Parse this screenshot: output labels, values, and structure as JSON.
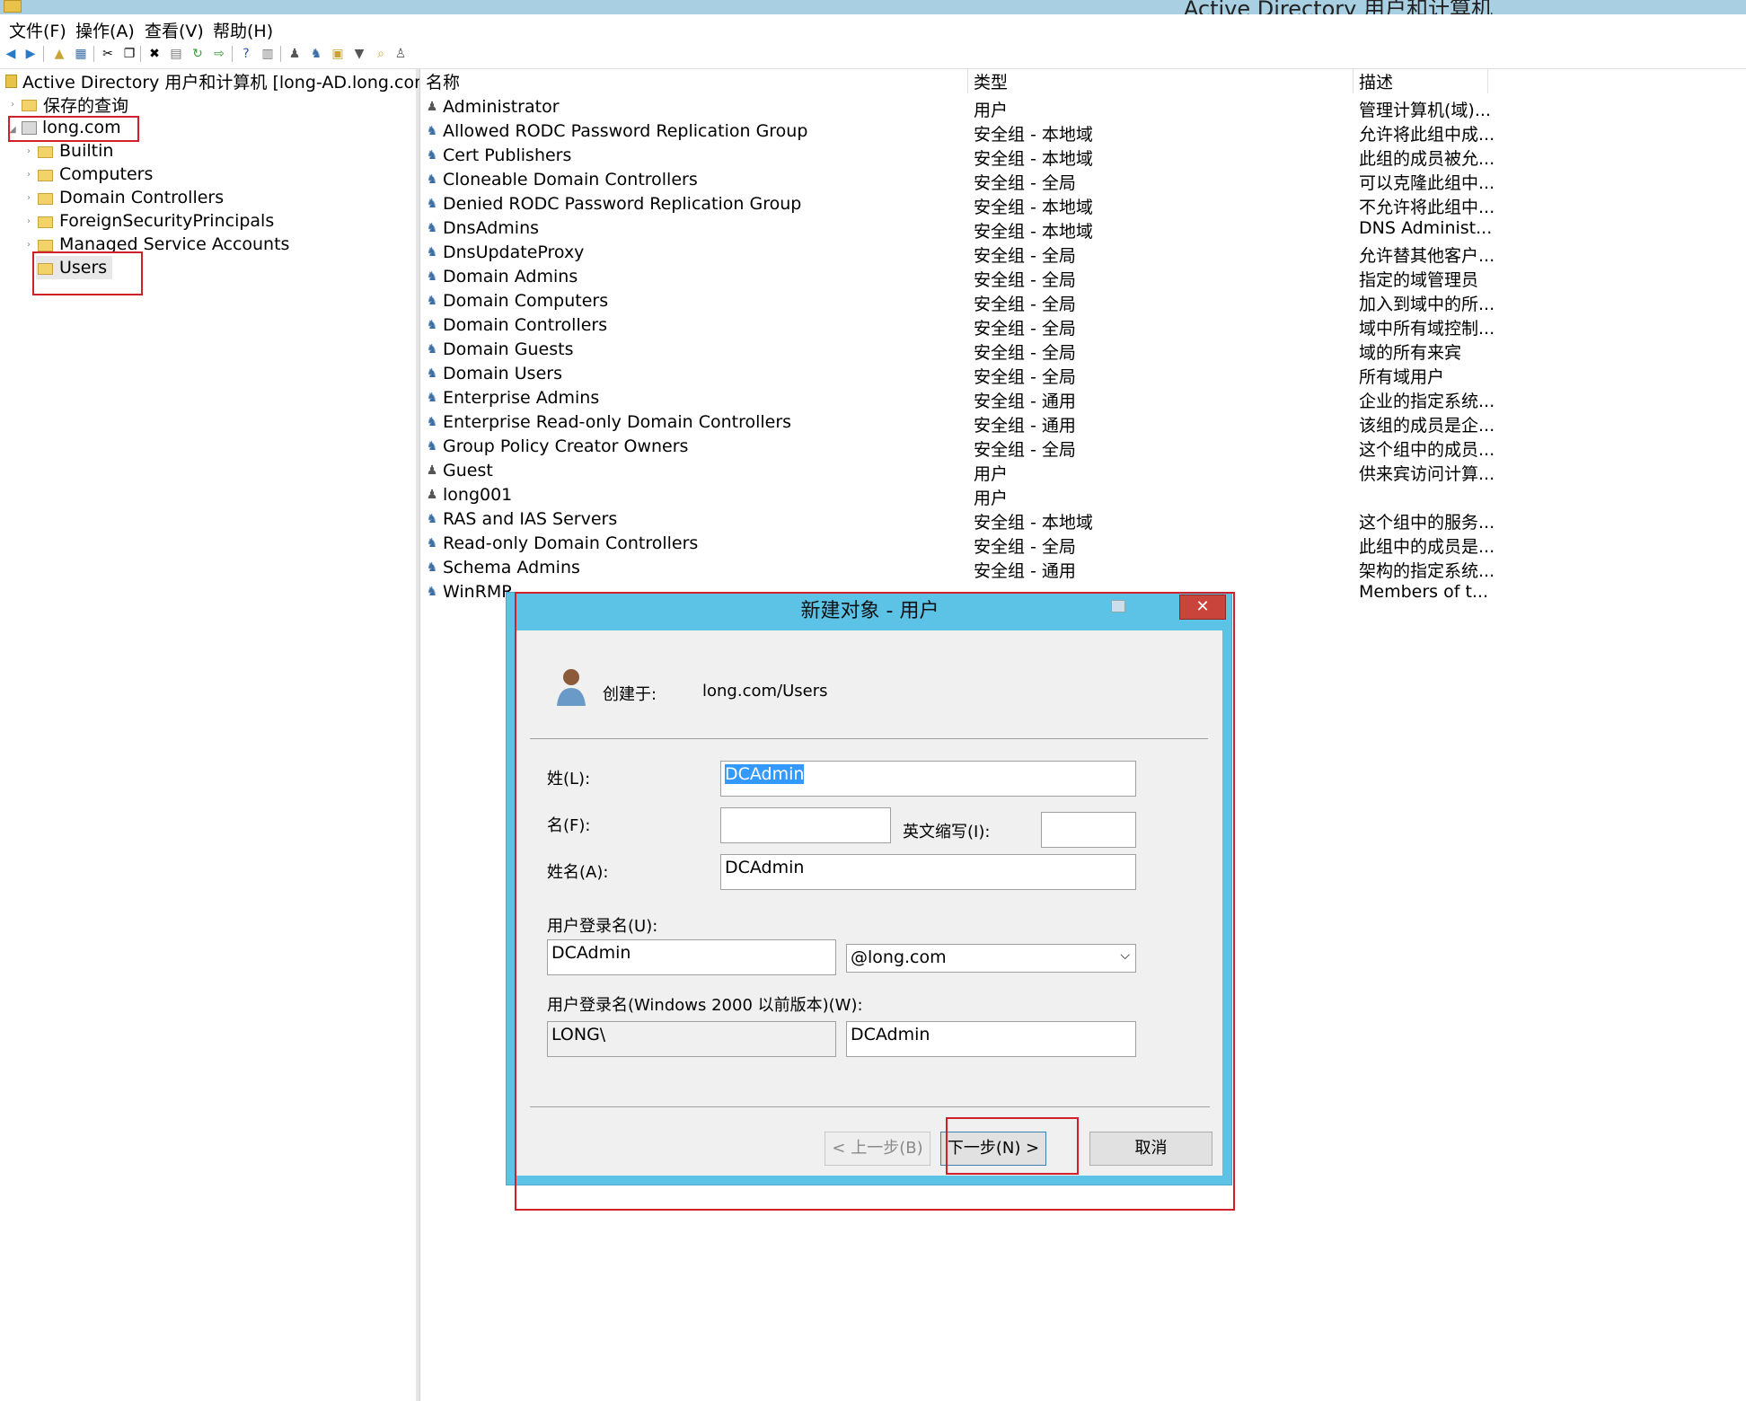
{
  "window": {
    "title": "Active Directory 用户和计算机"
  },
  "menu": [
    "文件(F)",
    "操作(A)",
    "查看(V)",
    "帮助(H)"
  ],
  "toolbar_icons": [
    "back-icon",
    "forward-icon",
    "up-icon",
    "console-tree-icon",
    "cut-icon",
    "copy-icon",
    "delete-icon",
    "properties-icon",
    "refresh-icon",
    "export-icon",
    "help-icon",
    "view-icon",
    "new-user-icon",
    "new-group-icon",
    "new-ou-icon",
    "filter-icon",
    "find-icon",
    "add-to-group-icon"
  ],
  "tree": {
    "root": "Active Directory 用户和计算机 [long-AD.long.com]",
    "saved_queries": "保存的查询",
    "domain": "long.com",
    "children": [
      "Builtin",
      "Computers",
      "Domain Controllers",
      "ForeignSecurityPrincipals",
      "Managed Service Accounts",
      "Users"
    ]
  },
  "list": {
    "columns": [
      "名称",
      "类型",
      "描述"
    ],
    "rows": [
      {
        "name": "Administrator",
        "type": "用户",
        "desc": "管理计算机(域)...",
        "kind": "user"
      },
      {
        "name": "Allowed RODC Password Replication Group",
        "type": "安全组 - 本地域",
        "desc": "允许将此组中成...",
        "kind": "group"
      },
      {
        "name": "Cert Publishers",
        "type": "安全组 - 本地域",
        "desc": "此组的成员被允...",
        "kind": "group"
      },
      {
        "name": "Cloneable Domain Controllers",
        "type": "安全组 - 全局",
        "desc": "可以克隆此组中...",
        "kind": "group"
      },
      {
        "name": "Denied RODC Password Replication Group",
        "type": "安全组 - 本地域",
        "desc": "不允许将此组中...",
        "kind": "group"
      },
      {
        "name": "DnsAdmins",
        "type": "安全组 - 本地域",
        "desc": "DNS Administ...",
        "kind": "group"
      },
      {
        "name": "DnsUpdateProxy",
        "type": "安全组 - 全局",
        "desc": "允许替其他客户...",
        "kind": "group"
      },
      {
        "name": "Domain Admins",
        "type": "安全组 - 全局",
        "desc": "指定的域管理员",
        "kind": "group"
      },
      {
        "name": "Domain Computers",
        "type": "安全组 - 全局",
        "desc": "加入到域中的所...",
        "kind": "group"
      },
      {
        "name": "Domain Controllers",
        "type": "安全组 - 全局",
        "desc": "域中所有域控制...",
        "kind": "group"
      },
      {
        "name": "Domain Guests",
        "type": "安全组 - 全局",
        "desc": "域的所有来宾",
        "kind": "group"
      },
      {
        "name": "Domain Users",
        "type": "安全组 - 全局",
        "desc": "所有域用户",
        "kind": "group"
      },
      {
        "name": "Enterprise Admins",
        "type": "安全组 - 通用",
        "desc": "企业的指定系统...",
        "kind": "group"
      },
      {
        "name": "Enterprise Read-only Domain Controllers",
        "type": "安全组 - 通用",
        "desc": "该组的成员是企...",
        "kind": "group"
      },
      {
        "name": "Group Policy Creator Owners",
        "type": "安全组 - 全局",
        "desc": "这个组中的成员...",
        "kind": "group"
      },
      {
        "name": "Guest",
        "type": "用户",
        "desc": "供来宾访问计算...",
        "kind": "user"
      },
      {
        "name": "long001",
        "type": "用户",
        "desc": "",
        "kind": "user"
      },
      {
        "name": "RAS and IAS Servers",
        "type": "安全组 - 本地域",
        "desc": "这个组中的服务...",
        "kind": "group"
      },
      {
        "name": "Read-only Domain Controllers",
        "type": "安全组 - 全局",
        "desc": "此组中的成员是...",
        "kind": "group"
      },
      {
        "name": "Schema Admins",
        "type": "安全组 - 通用",
        "desc": "架构的指定系统...",
        "kind": "group"
      },
      {
        "name": "WinRMR",
        "type": "",
        "desc": "Members of t...",
        "kind": "group"
      }
    ]
  },
  "dialog": {
    "title": "新建对象 - 用户",
    "close_label": "✕",
    "created_in_label": "创建于:",
    "created_in_value": "long.com/Users",
    "last_name_label": "姓(L):",
    "last_name_value": "DCAdmin",
    "first_name_label": "名(F):",
    "first_name_value": "",
    "initials_label": "英文缩写(I):",
    "initials_value": "",
    "full_name_label": "姓名(A):",
    "full_name_value": "DCAdmin",
    "logon_label": "用户登录名(U):",
    "logon_value": "DCAdmin",
    "domain_suffix": "@long.com",
    "pre2000_label": "用户登录名(Windows 2000 以前版本)(W):",
    "pre2000_domain": "LONG\\",
    "pre2000_value": "DCAdmin",
    "back_button": "< 上一步(B)",
    "next_button": "下一步(N) >",
    "cancel_button": "取消"
  }
}
